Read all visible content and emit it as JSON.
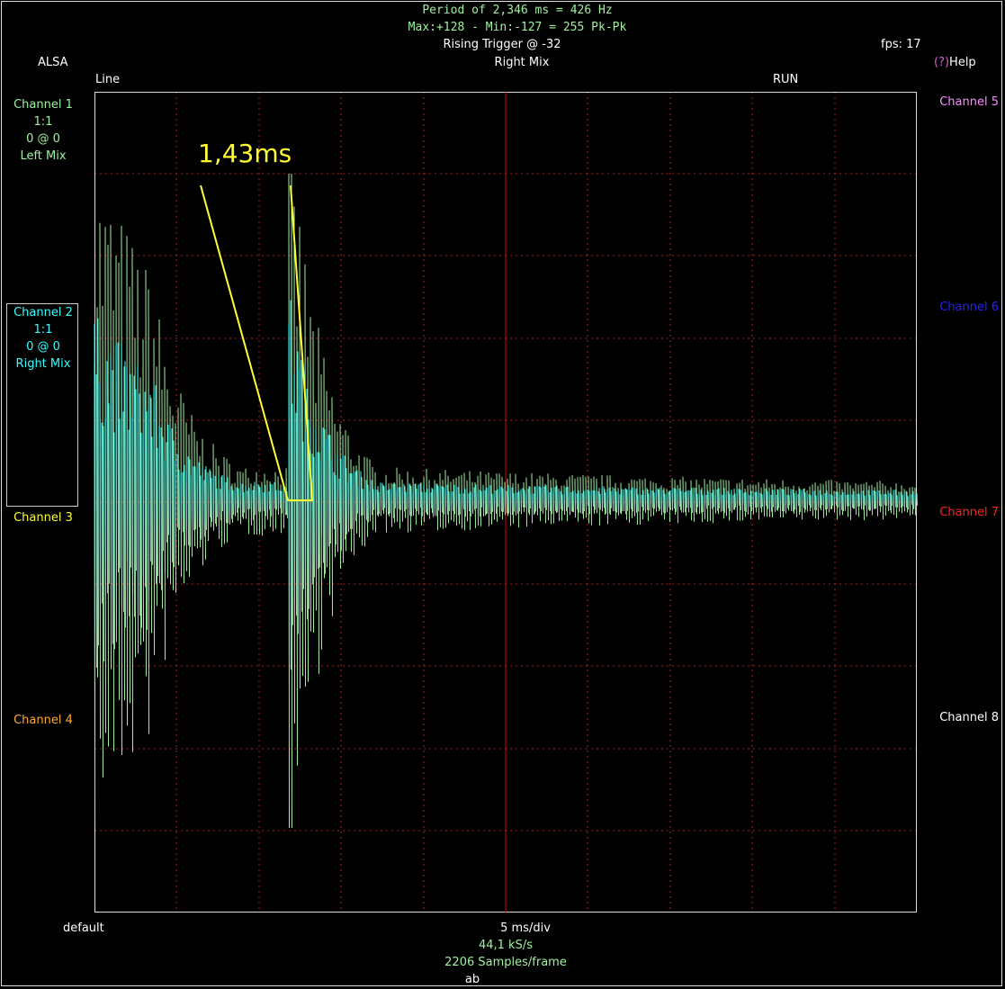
{
  "header": {
    "period_line": "Period of 2,346 ms =   426 Hz",
    "maxmin_line": "Max:+128 - Min:-127 = 255 Pk-Pk",
    "trigger": "Rising Trigger @ -32",
    "fps": "fps: 17",
    "driver": "ALSA",
    "source": "Right Mix",
    "help_prefix": "(?)",
    "help": "Help",
    "input": "Line",
    "run_state": "RUN"
  },
  "left_channels": {
    "ch1": {
      "name": "Channel 1",
      "scale": "1:1",
      "offset": "0 @ 0",
      "source": "Left Mix"
    },
    "ch2": {
      "name": "Channel 2",
      "scale": "1:1",
      "offset": "0 @ 0",
      "source": "Right Mix"
    },
    "ch3": {
      "name": "Channel 3"
    },
    "ch4": {
      "name": "Channel 4"
    }
  },
  "right_channels": {
    "ch5": "Channel 5",
    "ch6": "Channel 6",
    "ch7": "Channel 7",
    "ch8": "Channel 8"
  },
  "footer": {
    "device": "default",
    "timebase": "5 ms/div",
    "sample_rate": "44,1 kS/s",
    "samples": "2206 Samples/frame",
    "mode": "ab"
  },
  "annotation": {
    "text": "1,43ms"
  },
  "colors": {
    "ch1": "#a0f0a0",
    "ch2": "#33ffff",
    "ch3": "#ffff33",
    "ch4": "#ffaa33",
    "ch5": "#ff88ff",
    "ch6": "#2222ff",
    "ch7": "#ff2222",
    "ch8": "#ffffff",
    "help_prefix": "#cc66cc",
    "grid": "#aa2222",
    "cursor": "#dd0000",
    "annotation": "#ffff33"
  }
}
